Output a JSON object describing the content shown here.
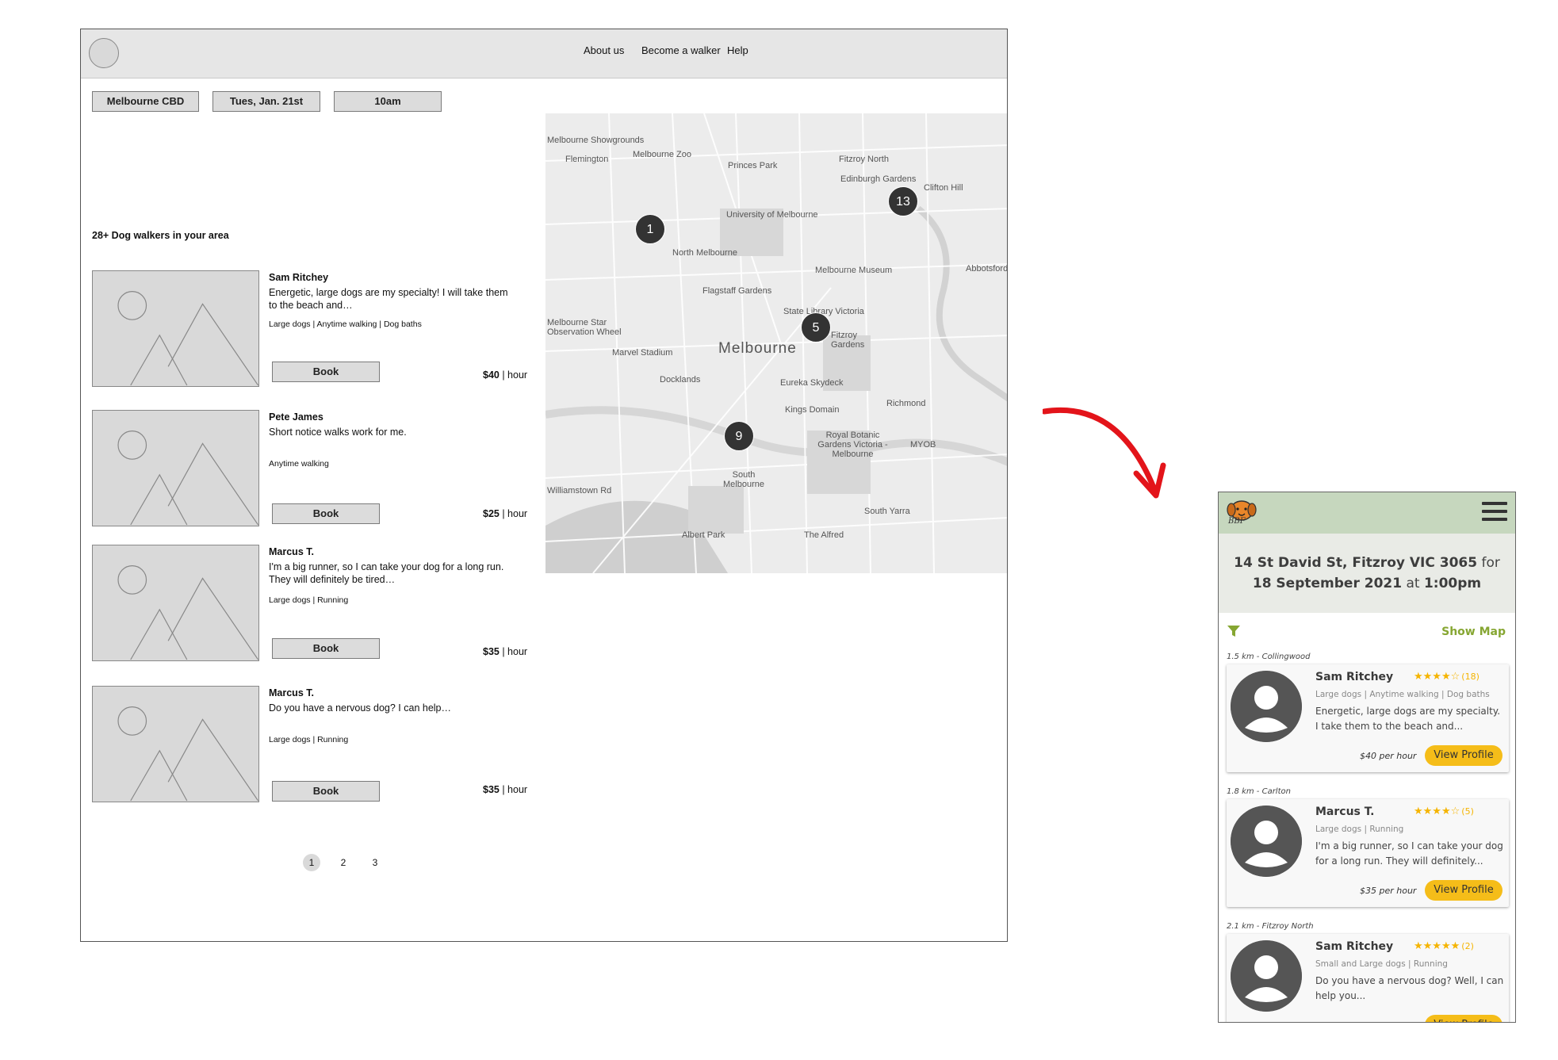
{
  "desktop": {
    "nav": [
      "About us",
      "Become a walker",
      "Help"
    ],
    "filters": {
      "location": "Melbourne CBD",
      "date": "Tues, Jan. 21st",
      "time": "10am"
    },
    "count_text": "28+ Dog walkers in your area",
    "walkers": [
      {
        "name": "Sam Ritchey",
        "desc": "Energetic, large dogs are my specialty! I will take them to the beach and…",
        "tags": "Large dogs | Anytime walking | Dog baths",
        "book": "Book",
        "price": "$40",
        "unit": " | hour"
      },
      {
        "name": "Pete James",
        "desc": "Short notice walks work for me.",
        "tags": "Anytime walking",
        "book": "Book",
        "price": "$25",
        "unit": " | hour"
      },
      {
        "name": "Marcus T.",
        "desc": "I'm a big runner, so I can take your dog for a long run. They will definitely be tired…",
        "tags": "Large dogs | Running",
        "book": "Book",
        "price": "$35",
        "unit": " | hour"
      },
      {
        "name": "Marcus T.",
        "desc": "Do you have a nervous dog? I can help…",
        "tags": "Large dogs | Running",
        "book": "Book",
        "price": "$35",
        "unit": " | hour"
      }
    ],
    "pages": [
      "1",
      "2",
      "3"
    ],
    "map": {
      "city_label": "Melbourne",
      "pins": [
        "1",
        "13",
        "5",
        "9"
      ],
      "labels": [
        "Melbourne Showgrounds",
        "Melbourne Zoo",
        "Flemington",
        "Princes Park",
        "Fitzroy North",
        "Edinburgh Gardens",
        "Clifton Hill",
        "University of Melbourne",
        "North Melbourne",
        "Melbourne Museum",
        "Abbotsford",
        "Flagstaff Gardens",
        "Melbourne Star Observation Wheel",
        "State Library Victoria",
        "Fitzroy Gardens",
        "Marvel Stadium",
        "Docklands",
        "Eureka Skydeck",
        "Kings Domain",
        "Richmond",
        "Royal Botanic Gardens Victoria - Melbourne",
        "MYOB",
        "South Melbourne",
        "Williamstown Rd",
        "Albert Park",
        "South Yarra",
        "The Alfred"
      ]
    }
  },
  "mobile": {
    "logo_text": "BBF",
    "search": {
      "address": "14 St David St, Fitzroy VIC 3065",
      "for_text": " for",
      "date": "18 September 2021",
      "at_text": " at ",
      "time": "1:00pm"
    },
    "show_map": "Show Map",
    "cards": [
      {
        "distance": "1.5 km - Collingwood",
        "name": "Sam Ritchey",
        "stars": "★★★★☆",
        "reviews": "(18)",
        "tags": "Large dogs | Anytime walking | Dog baths",
        "desc": "Energetic, large dogs are my specialty. I take them to the beach and...",
        "price": "$40 per hour",
        "button": "View Profile"
      },
      {
        "distance": "1.8 km - Carlton",
        "name": "Marcus T.",
        "stars": "★★★★☆",
        "reviews": "(5)",
        "tags": "Large dogs | Running",
        "desc": "I'm a big runner, so I can take your dog for a long run. They will definitely...",
        "price": "$35 per hour",
        "button": "View Profile"
      },
      {
        "distance": "2.1 km - Fitzroy North",
        "name": "Sam Ritchey",
        "stars": "★★★★★",
        "reviews": "(2)",
        "tags": "Small and Large dogs | Running",
        "desc": "Do you have a nervous dog? Well, I can help you...",
        "price": "",
        "button": "View Profile"
      }
    ],
    "colors": {
      "header": "#c6d7be",
      "accent": "#86a632",
      "button": "#f5bd19",
      "stars": "#f5b400"
    }
  }
}
